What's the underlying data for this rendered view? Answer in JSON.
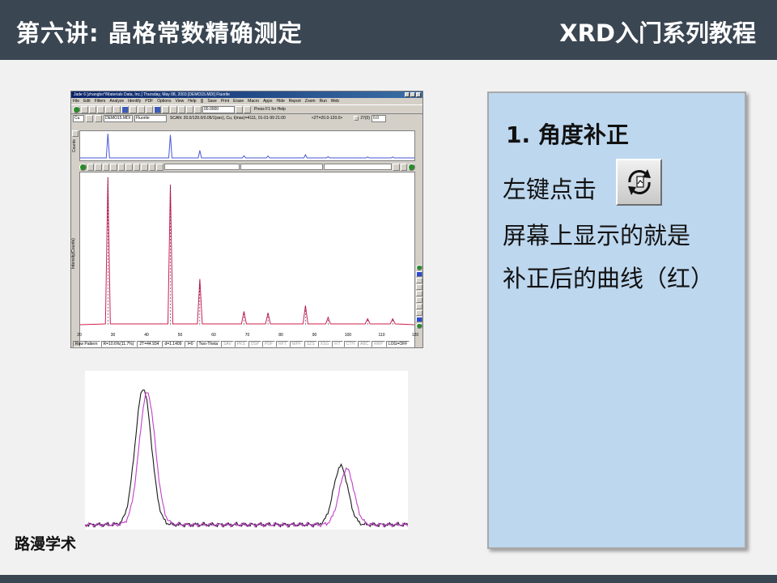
{
  "header": {
    "title_left": "第六讲: 晶格常数精确测定",
    "title_right": "XRD入门系列教程"
  },
  "brand": "路漫学术",
  "jade": {
    "title": "Jade 6 [zhangbo*/Materials Data, Inc.] Thursday, May 08, 2003 [DEMO15.MDI] Fluorite",
    "menu": [
      "File",
      "Edit",
      "Filters",
      "Analyze",
      "Identify",
      "PDF",
      "Options",
      "View",
      "Help",
      "|||",
      "Save",
      "Print",
      "Erase",
      "Macro",
      "Apps",
      "Hide",
      "Report",
      "Zoom",
      "Run",
      "Web"
    ],
    "toolbar_value": "00.0000",
    "help_hint": "Press F1 for Help",
    "element": "Cu",
    "file": "DEMO15.MDI",
    "sample": "Fluorite",
    "scan_info": "SCAN: 20.0/120.0/0.05/1(sec), Cu, I(max)=4111, 01-01-99 21:00",
    "range_info": "<2T=20.0-120.0>",
    "range_val": "27(0)",
    "range_box": "0.0",
    "overview_label": "Counts",
    "y_axis_label": "Intensity(Counts)",
    "x_ticks": [
      "20",
      "30",
      "40",
      "50",
      "60",
      "70",
      "80",
      "90",
      "100",
      "110",
      "120"
    ],
    "status": {
      "raw": "Raw Pattern",
      "r": "R=10.6%(11.7%)",
      "twotheta": "2T=44.934",
      "d": "d=1.1409",
      "i": "I=0",
      "axis": "Two-Theta",
      "dims": [
        "SAV",
        "PKS",
        "DSP",
        "PDF",
        "RFT",
        "WPF",
        "SZS",
        "XSG",
        "FIT",
        "CTH",
        "ABC",
        "RRP"
      ],
      "log": "LOG=OFF"
    },
    "colors": {
      "raw": "#d01f4a",
      "corrected": "#2a2a80",
      "overview": "#4757d6"
    }
  },
  "panel": {
    "step": "1. 角度补正",
    "line1": "左键点击",
    "line2": "屏幕上显示的就是",
    "line3": "补正后的曲线（红）",
    "icon": "refresh-correct-icon"
  },
  "chart_data": [
    {
      "type": "line",
      "title": "",
      "xlabel": "",
      "ylabel": "Intensity(Counts)",
      "xlim": [
        20,
        120
      ],
      "series": [
        {
          "name": "",
          "color": "#d01f4a",
          "peaks": [
            [
              28.3,
              100
            ],
            [
              47.0,
              95
            ],
            [
              55.8,
              31
            ],
            [
              69.0,
              9
            ],
            [
              76.2,
              8
            ],
            [
              87.4,
              13
            ],
            [
              94.2,
              5
            ],
            [
              106.0,
              4
            ],
            [
              113.5,
              4
            ]
          ]
        }
      ]
    },
    {
      "type": "line",
      "xlabel": "",
      "ylabel": "",
      "series": [
        {
          "name": "",
          "color": "#1a1a1a",
          "peaks": [
            [
              0.0,
              1.0
            ],
            [
              1.0,
              0.43
            ]
          ]
        },
        {
          "name": "",
          "color": "#c040c8",
          "peaks": [
            [
              0.02,
              0.97
            ],
            [
              1.03,
              0.41
            ]
          ]
        }
      ]
    }
  ]
}
